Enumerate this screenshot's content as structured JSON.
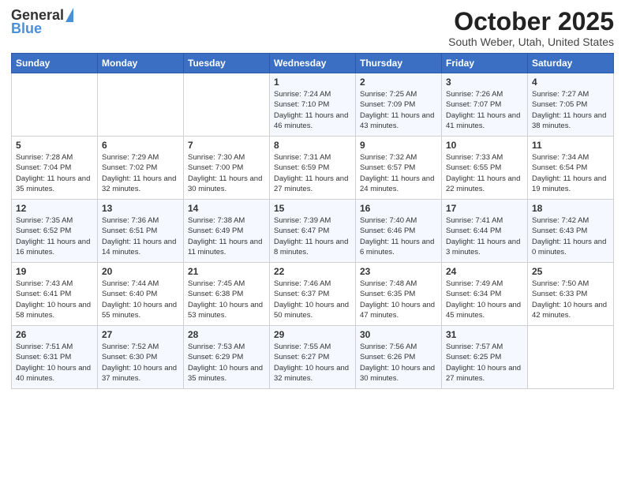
{
  "logo": {
    "general": "General",
    "blue": "Blue"
  },
  "header": {
    "month": "October 2025",
    "location": "South Weber, Utah, United States"
  },
  "days_of_week": [
    "Sunday",
    "Monday",
    "Tuesday",
    "Wednesday",
    "Thursday",
    "Friday",
    "Saturday"
  ],
  "weeks": [
    [
      {
        "day": "",
        "sunrise": "",
        "sunset": "",
        "daylight": ""
      },
      {
        "day": "",
        "sunrise": "",
        "sunset": "",
        "daylight": ""
      },
      {
        "day": "",
        "sunrise": "",
        "sunset": "",
        "daylight": ""
      },
      {
        "day": "1",
        "sunrise": "Sunrise: 7:24 AM",
        "sunset": "Sunset: 7:10 PM",
        "daylight": "Daylight: 11 hours and 46 minutes."
      },
      {
        "day": "2",
        "sunrise": "Sunrise: 7:25 AM",
        "sunset": "Sunset: 7:09 PM",
        "daylight": "Daylight: 11 hours and 43 minutes."
      },
      {
        "day": "3",
        "sunrise": "Sunrise: 7:26 AM",
        "sunset": "Sunset: 7:07 PM",
        "daylight": "Daylight: 11 hours and 41 minutes."
      },
      {
        "day": "4",
        "sunrise": "Sunrise: 7:27 AM",
        "sunset": "Sunset: 7:05 PM",
        "daylight": "Daylight: 11 hours and 38 minutes."
      }
    ],
    [
      {
        "day": "5",
        "sunrise": "Sunrise: 7:28 AM",
        "sunset": "Sunset: 7:04 PM",
        "daylight": "Daylight: 11 hours and 35 minutes."
      },
      {
        "day": "6",
        "sunrise": "Sunrise: 7:29 AM",
        "sunset": "Sunset: 7:02 PM",
        "daylight": "Daylight: 11 hours and 32 minutes."
      },
      {
        "day": "7",
        "sunrise": "Sunrise: 7:30 AM",
        "sunset": "Sunset: 7:00 PM",
        "daylight": "Daylight: 11 hours and 30 minutes."
      },
      {
        "day": "8",
        "sunrise": "Sunrise: 7:31 AM",
        "sunset": "Sunset: 6:59 PM",
        "daylight": "Daylight: 11 hours and 27 minutes."
      },
      {
        "day": "9",
        "sunrise": "Sunrise: 7:32 AM",
        "sunset": "Sunset: 6:57 PM",
        "daylight": "Daylight: 11 hours and 24 minutes."
      },
      {
        "day": "10",
        "sunrise": "Sunrise: 7:33 AM",
        "sunset": "Sunset: 6:55 PM",
        "daylight": "Daylight: 11 hours and 22 minutes."
      },
      {
        "day": "11",
        "sunrise": "Sunrise: 7:34 AM",
        "sunset": "Sunset: 6:54 PM",
        "daylight": "Daylight: 11 hours and 19 minutes."
      }
    ],
    [
      {
        "day": "12",
        "sunrise": "Sunrise: 7:35 AM",
        "sunset": "Sunset: 6:52 PM",
        "daylight": "Daylight: 11 hours and 16 minutes."
      },
      {
        "day": "13",
        "sunrise": "Sunrise: 7:36 AM",
        "sunset": "Sunset: 6:51 PM",
        "daylight": "Daylight: 11 hours and 14 minutes."
      },
      {
        "day": "14",
        "sunrise": "Sunrise: 7:38 AM",
        "sunset": "Sunset: 6:49 PM",
        "daylight": "Daylight: 11 hours and 11 minutes."
      },
      {
        "day": "15",
        "sunrise": "Sunrise: 7:39 AM",
        "sunset": "Sunset: 6:47 PM",
        "daylight": "Daylight: 11 hours and 8 minutes."
      },
      {
        "day": "16",
        "sunrise": "Sunrise: 7:40 AM",
        "sunset": "Sunset: 6:46 PM",
        "daylight": "Daylight: 11 hours and 6 minutes."
      },
      {
        "day": "17",
        "sunrise": "Sunrise: 7:41 AM",
        "sunset": "Sunset: 6:44 PM",
        "daylight": "Daylight: 11 hours and 3 minutes."
      },
      {
        "day": "18",
        "sunrise": "Sunrise: 7:42 AM",
        "sunset": "Sunset: 6:43 PM",
        "daylight": "Daylight: 11 hours and 0 minutes."
      }
    ],
    [
      {
        "day": "19",
        "sunrise": "Sunrise: 7:43 AM",
        "sunset": "Sunset: 6:41 PM",
        "daylight": "Daylight: 10 hours and 58 minutes."
      },
      {
        "day": "20",
        "sunrise": "Sunrise: 7:44 AM",
        "sunset": "Sunset: 6:40 PM",
        "daylight": "Daylight: 10 hours and 55 minutes."
      },
      {
        "day": "21",
        "sunrise": "Sunrise: 7:45 AM",
        "sunset": "Sunset: 6:38 PM",
        "daylight": "Daylight: 10 hours and 53 minutes."
      },
      {
        "day": "22",
        "sunrise": "Sunrise: 7:46 AM",
        "sunset": "Sunset: 6:37 PM",
        "daylight": "Daylight: 10 hours and 50 minutes."
      },
      {
        "day": "23",
        "sunrise": "Sunrise: 7:48 AM",
        "sunset": "Sunset: 6:35 PM",
        "daylight": "Daylight: 10 hours and 47 minutes."
      },
      {
        "day": "24",
        "sunrise": "Sunrise: 7:49 AM",
        "sunset": "Sunset: 6:34 PM",
        "daylight": "Daylight: 10 hours and 45 minutes."
      },
      {
        "day": "25",
        "sunrise": "Sunrise: 7:50 AM",
        "sunset": "Sunset: 6:33 PM",
        "daylight": "Daylight: 10 hours and 42 minutes."
      }
    ],
    [
      {
        "day": "26",
        "sunrise": "Sunrise: 7:51 AM",
        "sunset": "Sunset: 6:31 PM",
        "daylight": "Daylight: 10 hours and 40 minutes."
      },
      {
        "day": "27",
        "sunrise": "Sunrise: 7:52 AM",
        "sunset": "Sunset: 6:30 PM",
        "daylight": "Daylight: 10 hours and 37 minutes."
      },
      {
        "day": "28",
        "sunrise": "Sunrise: 7:53 AM",
        "sunset": "Sunset: 6:29 PM",
        "daylight": "Daylight: 10 hours and 35 minutes."
      },
      {
        "day": "29",
        "sunrise": "Sunrise: 7:55 AM",
        "sunset": "Sunset: 6:27 PM",
        "daylight": "Daylight: 10 hours and 32 minutes."
      },
      {
        "day": "30",
        "sunrise": "Sunrise: 7:56 AM",
        "sunset": "Sunset: 6:26 PM",
        "daylight": "Daylight: 10 hours and 30 minutes."
      },
      {
        "day": "31",
        "sunrise": "Sunrise: 7:57 AM",
        "sunset": "Sunset: 6:25 PM",
        "daylight": "Daylight: 10 hours and 27 minutes."
      },
      {
        "day": "",
        "sunrise": "",
        "sunset": "",
        "daylight": ""
      }
    ]
  ]
}
